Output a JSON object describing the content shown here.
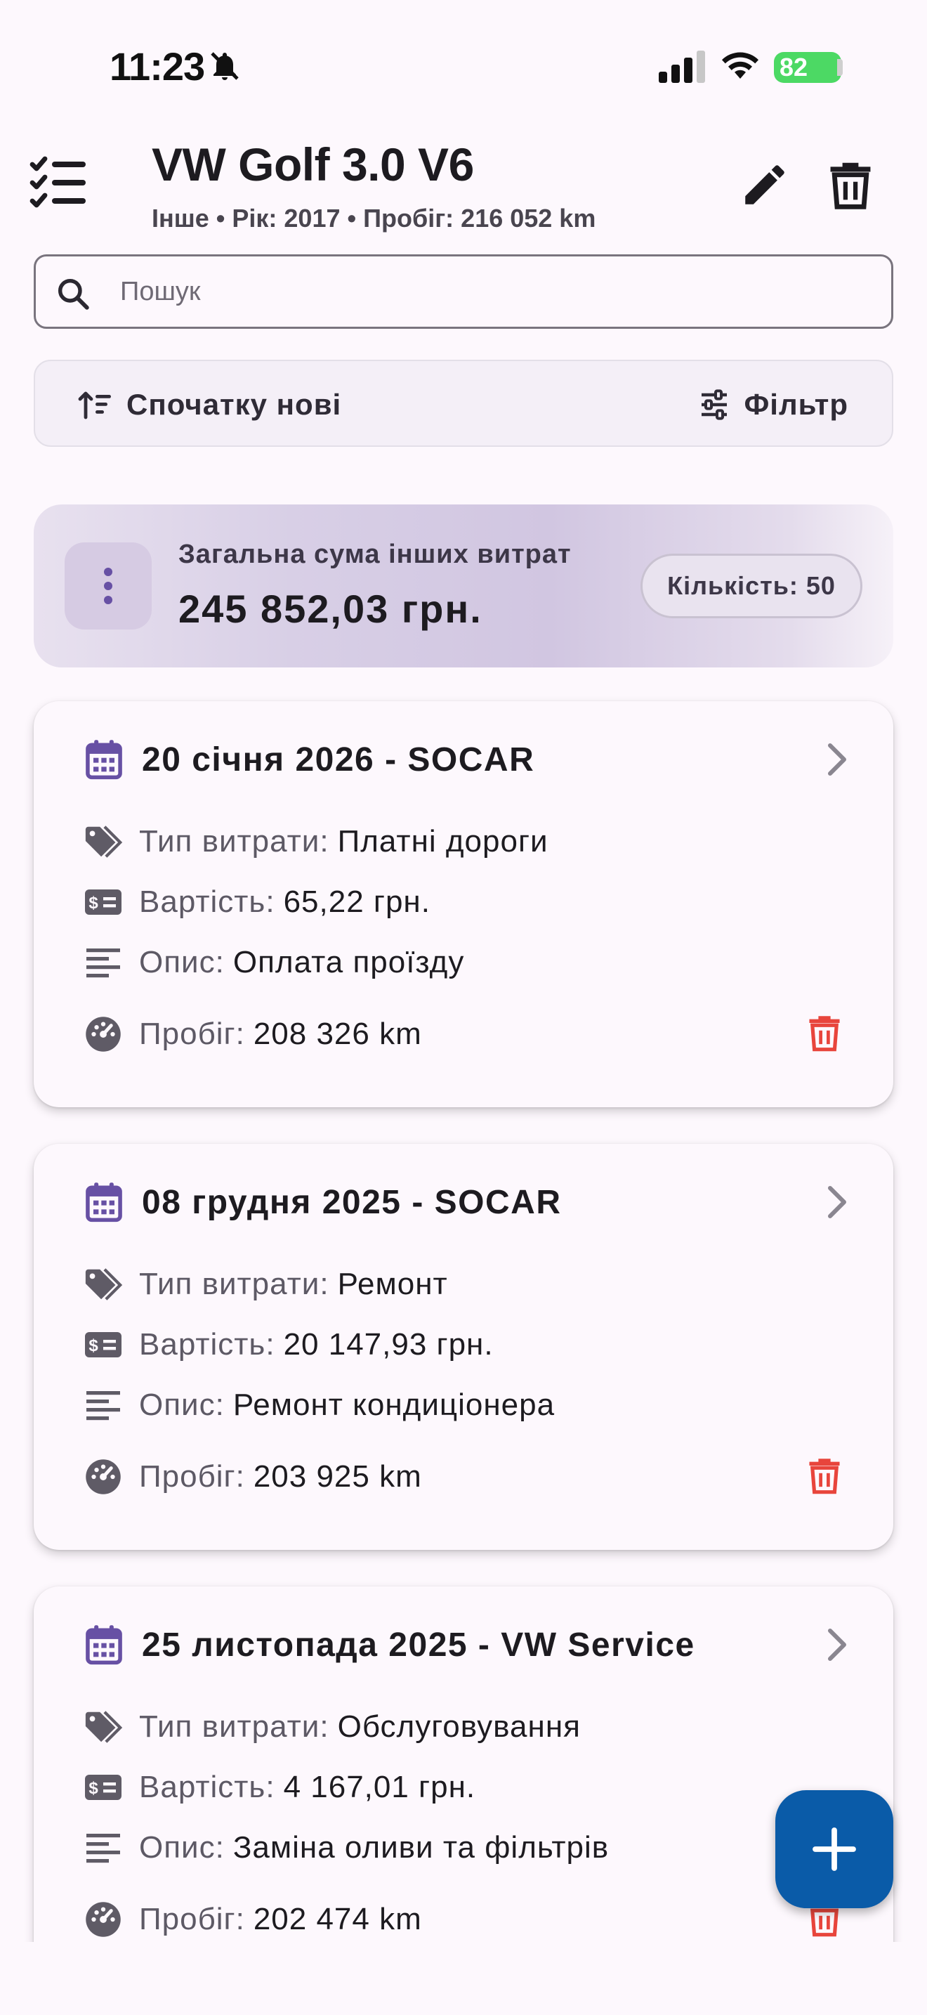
{
  "status": {
    "time": "11:23",
    "battery": "82"
  },
  "header": {
    "title": "VW Golf 3.0 V6",
    "subtitle": "Інше • Рік: 2017 • Пробіг: 216 052 km"
  },
  "search": {
    "placeholder": "Пошук",
    "value": ""
  },
  "sortbar": {
    "sort_label": "Спочатку нові",
    "filter_label": "Фільтр"
  },
  "summary": {
    "label": "Загальна сума інших витрат",
    "total": "245 852,03 грн.",
    "count": "Кількість: 50"
  },
  "labels": {
    "type": "Тип витрати:",
    "cost": "Вартість:",
    "desc": "Опис:",
    "mileage": "Пробіг:"
  },
  "expenses": [
    {
      "title": "20 січня 2026 - SOCAR",
      "type": "Платні дороги",
      "cost": "65,22 грн.",
      "desc": "Оплата проїзду",
      "mileage": "208 326 km"
    },
    {
      "title": "08 грудня 2025 - SOCAR",
      "type": "Ремонт",
      "cost": "20 147,93 грн.",
      "desc": "Ремонт кондиціонера",
      "mileage": "203 925 km"
    },
    {
      "title": "25 листопада 2025 - VW Service",
      "type": "Обслуговування",
      "cost": "4 167,01 грн.",
      "desc": "Заміна оливи та фільтрів",
      "mileage": "202 474 km"
    }
  ],
  "colors": {
    "accent": "#6750a4",
    "fab": "#0a5ba8",
    "delete": "#e8453c",
    "icon": "#5f5b66"
  },
  "icons": {
    "menu": "checklist-icon",
    "edit": "pencil-icon",
    "delete": "trash-icon",
    "search": "search-icon",
    "sort": "sort-icon",
    "filter": "tune-icon",
    "summary": "more-vert-icon",
    "calendar": "calendar-icon",
    "tag": "tag-icon",
    "cost": "money-icon",
    "desc": "notes-icon",
    "mileage": "speedometer-icon",
    "chevron": "chevron-right-icon",
    "fab": "plus-icon"
  }
}
